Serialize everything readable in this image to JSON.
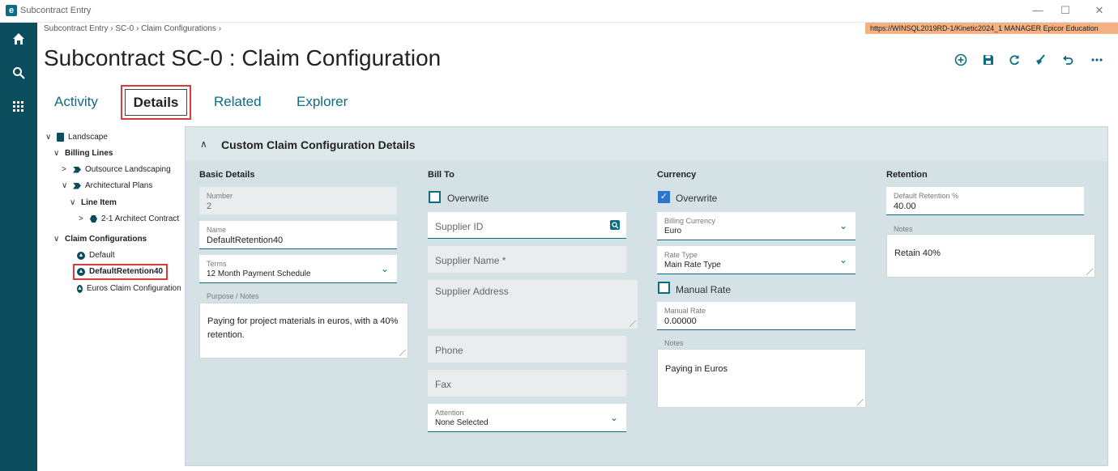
{
  "window": {
    "title": "Subcontract Entry",
    "logo_letter": "e",
    "minimize": "—",
    "maximize": "☐",
    "close": "✕"
  },
  "breadcrumb": {
    "items": [
      "Subcontract Entry",
      "SC-0",
      "Claim Configurations"
    ],
    "separator": "›"
  },
  "server_badge": "https://WINSQL2019RD-1/Kinetic2024_1   MANAGER   Epicor Education",
  "page_title": "Subcontract SC-0 : Claim Configuration",
  "toolbar_icons": [
    "add-icon",
    "save-icon",
    "refresh-icon",
    "clear-icon",
    "undo-icon",
    "more-icon"
  ],
  "tabs": [
    "Activity",
    "Details",
    "Related",
    "Explorer"
  ],
  "tree": {
    "root": "Landscape",
    "billing_lines": "Billing Lines",
    "outsource": "Outsource Landscaping",
    "architectural": "Architectural Plans",
    "line_item": "Line Item",
    "contract": "2-1 Architect Contract",
    "claim_configs": "Claim Configurations",
    "default": "Default",
    "default_retention": "DefaultRetention40",
    "euros": "Euros Claim Configuration"
  },
  "panel": {
    "title": "Custom Claim Configuration Details"
  },
  "basic": {
    "section": "Basic Details",
    "number_label": "Number",
    "number_value": "2",
    "name_label": "Name",
    "name_value": "DefaultRetention40",
    "terms_label": "Terms",
    "terms_value": "12 Month Payment Schedule",
    "purpose_label": "Purpose / Notes",
    "purpose_value": "Paying for project materials in euros, with a 40% retention."
  },
  "billto": {
    "section": "Bill To",
    "overwrite": "Overwrite",
    "supplier_id": "Supplier ID",
    "supplier_name": "Supplier Name *",
    "supplier_address": "Supplier Address",
    "phone": "Phone",
    "fax": "Fax",
    "attention_label": "Attention",
    "attention_value": "None Selected"
  },
  "currency": {
    "section": "Currency",
    "overwrite": "Overwrite",
    "billing_currency_label": "Billing Currency",
    "billing_currency_value": "Euro",
    "rate_type_label": "Rate Type",
    "rate_type_value": "Main Rate Type",
    "manual_rate_cb": "Manual Rate",
    "manual_rate_label": "Manual Rate",
    "manual_rate_value": "0.00000",
    "notes_label": "Notes",
    "notes_value": "Paying in Euros"
  },
  "retention": {
    "section": "Retention",
    "default_pct_label": "Default Retention %",
    "default_pct_value": "40.00",
    "notes_label": "Notes",
    "notes_value": "Retain 40%"
  }
}
